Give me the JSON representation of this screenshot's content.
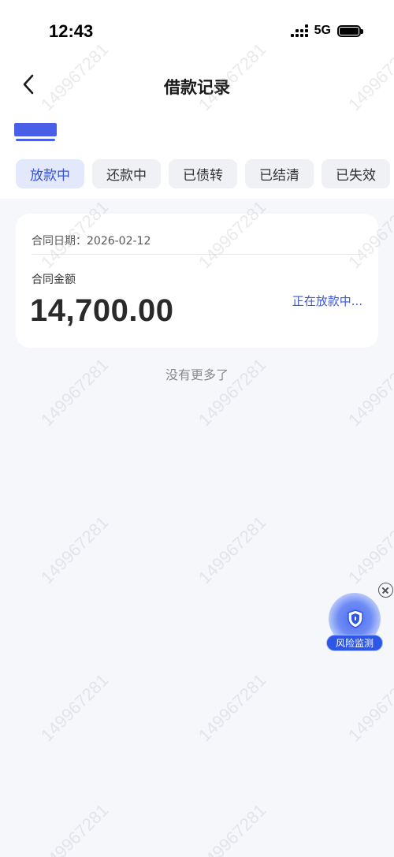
{
  "status_bar": {
    "time": "12:43",
    "network": "5G"
  },
  "header": {
    "title": "借款记录"
  },
  "tabs": [
    {
      "label": "放款中",
      "active": true
    },
    {
      "label": "还款中",
      "active": false
    },
    {
      "label": "已债转",
      "active": false
    },
    {
      "label": "已结清",
      "active": false
    },
    {
      "label": "已失效",
      "active": false
    }
  ],
  "record": {
    "date_label": "合同日期：",
    "date_value": "2026-02-12",
    "amount_label": "合同金额",
    "amount_value": "14,700.00",
    "status_text": "正在放款中..."
  },
  "list_footer": "没有更多了",
  "risk_widget": {
    "label": "风险监测"
  },
  "watermark": "149967281",
  "colors": {
    "accent": "#3f5ad8",
    "active_tab_bg": "#e3e8fb",
    "page_bg": "#f6f7fb"
  }
}
